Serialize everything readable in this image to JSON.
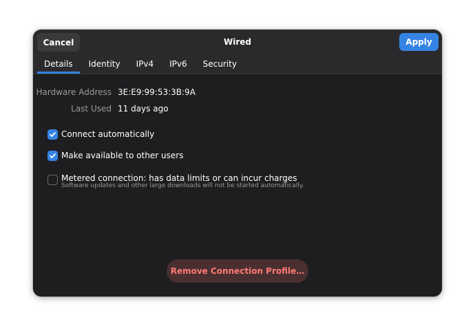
{
  "header": {
    "title": "Wired",
    "cancel_label": "Cancel",
    "apply_label": "Apply"
  },
  "tabs": [
    {
      "label": "Details",
      "active": true
    },
    {
      "label": "Identity",
      "active": false
    },
    {
      "label": "IPv4",
      "active": false
    },
    {
      "label": "IPv6",
      "active": false
    },
    {
      "label": "Security",
      "active": false
    }
  ],
  "details": {
    "hardware_address_label": "Hardware Address",
    "hardware_address_value": "3E:E9:99:53:3B:9A",
    "last_used_label": "Last Used",
    "last_used_value": "11 days ago"
  },
  "options": {
    "connect_automatically": {
      "label": "Connect automatically",
      "checked": true
    },
    "make_available": {
      "label": "Make available to other users",
      "checked": true
    },
    "metered": {
      "label": "Metered connection: has data limits or can incur charges",
      "sublabel": "Software updates and other large downloads will not be started automatically.",
      "checked": false
    }
  },
  "remove_label": "Remove Connection Profile…",
  "colors": {
    "accent": "#3584e4",
    "destructive": "#ff7b73",
    "background": "#1e1e21"
  }
}
